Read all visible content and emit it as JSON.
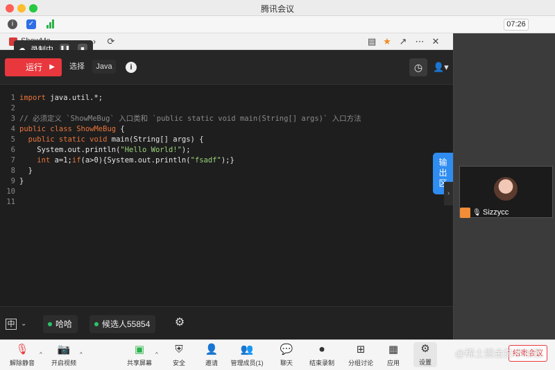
{
  "window": {
    "title": "腾讯会议",
    "clock": "07:26"
  },
  "browser": {
    "tab_title": "ShowMe"
  },
  "recording": {
    "label": "录制中"
  },
  "editor": {
    "run_label": "运行",
    "select_label": "选择",
    "language_label": "Java",
    "output_tab_label": "输出区",
    "code_lines": [
      {
        "n": "1",
        "t": "import java.util.*;"
      },
      {
        "n": "2",
        "t": ""
      },
      {
        "n": "3",
        "t": "// 必须定义 `ShowMeBug` 入口类和 `public static void main(String[] args)` 入口方法"
      },
      {
        "n": "4",
        "t": "public class ShowMeBug {"
      },
      {
        "n": "5",
        "t": "  public static void main(String[] args) {"
      },
      {
        "n": "6",
        "t": "    System.out.println(\"Hello World!\");"
      },
      {
        "n": "7",
        "t": "    int a=1;if(a>0){System.out.println(\"fsadf\");}"
      },
      {
        "n": "8",
        "t": "  }"
      },
      {
        "n": "9",
        "t": "}"
      },
      {
        "n": "10",
        "t": ""
      },
      {
        "n": "11",
        "t": ""
      }
    ],
    "ime_label": "中",
    "participant_1": "哈哈",
    "participant_2": "候选人55854"
  },
  "video": {
    "name": "Sizzycc"
  },
  "meeting_bar": {
    "unmute": "解除静音",
    "start_video": "开启视频",
    "share_screen": "共享屏幕",
    "security": "安全",
    "invite": "邀请",
    "members": "管理成员(1)",
    "chat": "聊天",
    "end_recording": "结束录制",
    "breakout": "分组讨论",
    "apps": "应用",
    "settings": "设置",
    "end_meeting": "结束会议"
  },
  "watermark": "@稀土掘金技术社区",
  "colors": {
    "run": "#e8383d",
    "output_tab": "#2f8cf0",
    "online_dot": "#2bc46b"
  }
}
